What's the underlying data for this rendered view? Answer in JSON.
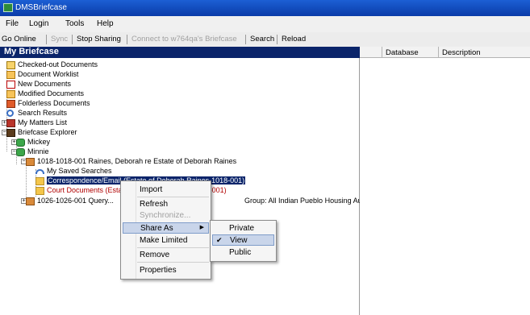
{
  "window": {
    "title": "DMSBriefcase"
  },
  "menubar": [
    "File",
    "Login",
    "Tools",
    "Help"
  ],
  "toolbar": {
    "go_online": "Go Online",
    "sync": "Sync",
    "stop_sharing": "Stop Sharing",
    "connect": "Connect to w764qa's Briefcase",
    "search": "Search",
    "reload": "Reload"
  },
  "left_pane": {
    "header": "My Briefcase"
  },
  "tree": {
    "checked_out": "Checked-out Documents",
    "worklist": "Document Worklist",
    "new_docs": "New Documents",
    "modified_docs": "Modified Documents",
    "folderless": "Folderless Documents",
    "search_results": "Search Results",
    "matters_list": "My Matters List",
    "briefcase_explorer": "Briefcase Explorer",
    "db_mickey": "Mickey",
    "db_minnie": "Minnie",
    "matter1": "1018-1018-001 Raines, Deborah re Estate of Deborah Raines",
    "saved_searches": "My Saved Searches",
    "folder_correspondence": "Correspondence/Email (Estate of Deborah Raines-1018-001)",
    "folder_court": "Court Documents (Estate of Deborah Raines-1018-001)",
    "matter2_left": "1026-1026-001 Query...",
    "matter2_right": "Group: All Indian Pueblo Housing Authority"
  },
  "right_pane": {
    "columns": [
      "Database",
      "Description"
    ]
  },
  "context_menu": {
    "items": [
      "Import",
      "Refresh",
      "Synchronize...",
      "Share As",
      "Make Limited",
      "Remove",
      "Properties"
    ]
  },
  "share_submenu": {
    "items": [
      "Private",
      "View",
      "Public"
    ],
    "checked": "View"
  }
}
